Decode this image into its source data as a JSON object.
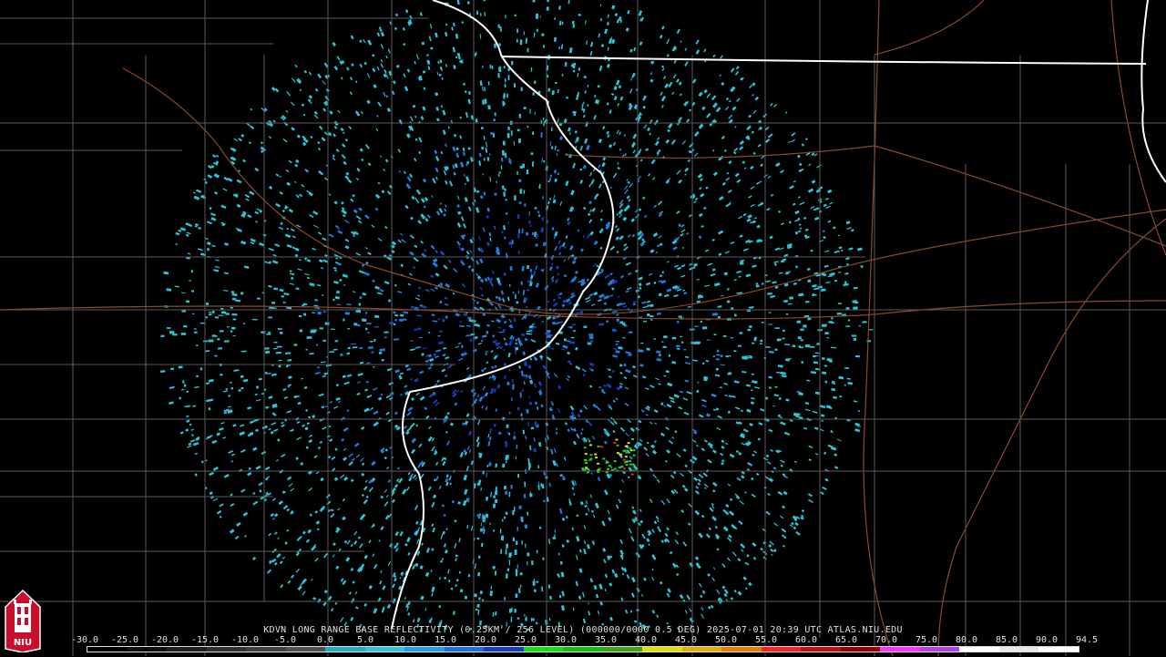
{
  "map": {
    "radar_site_marker": "radar-site-dot",
    "colors": {
      "background": "#000000",
      "county_lines": "#5a5a5a",
      "state_lines": "#ffffff",
      "highways": "#8a4a2a",
      "echo_light": "#29c5d8",
      "echo_mid": "#1f7ee0",
      "echo_dark": "#1040c0",
      "echo_green": "#22cc22",
      "echo_yellow": "#e0e000",
      "echo_red": "#ff2020"
    }
  },
  "caption": {
    "text": "KDVN LONG RANGE BASE REFLECTIVITY (0.25KM / 256 LEVEL) (000000/0000 0.5 DEG) 2025-07-01 20:39 UTC  ATLAS.NIU.EDU"
  },
  "color_scale": {
    "labels": [
      "-30.0",
      "-25.0",
      "-20.0",
      "-15.0",
      "-10.0",
      "-5.0",
      "0.0",
      "5.0",
      "10.0",
      "15.0",
      "20.0",
      "25.0",
      "30.0",
      "35.0",
      "40.0",
      "45.0",
      "50.0",
      "55.0",
      "60.0",
      "65.0",
      "70.0",
      "75.0",
      "80.0",
      "85.0",
      "90.0",
      "94.5"
    ],
    "colors": [
      "#000000",
      "#101010",
      "#202020",
      "#303030",
      "#404040",
      "#505050",
      "#1ab0c0",
      "#29c5d8",
      "#1f9de8",
      "#1f6ee0",
      "#1040c0",
      "#10e010",
      "#10c010",
      "#40a020",
      "#e0e000",
      "#e0b000",
      "#e08000",
      "#ff2020",
      "#c01010",
      "#900000",
      "#ff30ff",
      "#b040e0",
      "#ffffff",
      "#e8e8e8",
      "#ffffff"
    ]
  },
  "logo": {
    "text": "NIU",
    "icon": "university-tower-icon"
  }
}
